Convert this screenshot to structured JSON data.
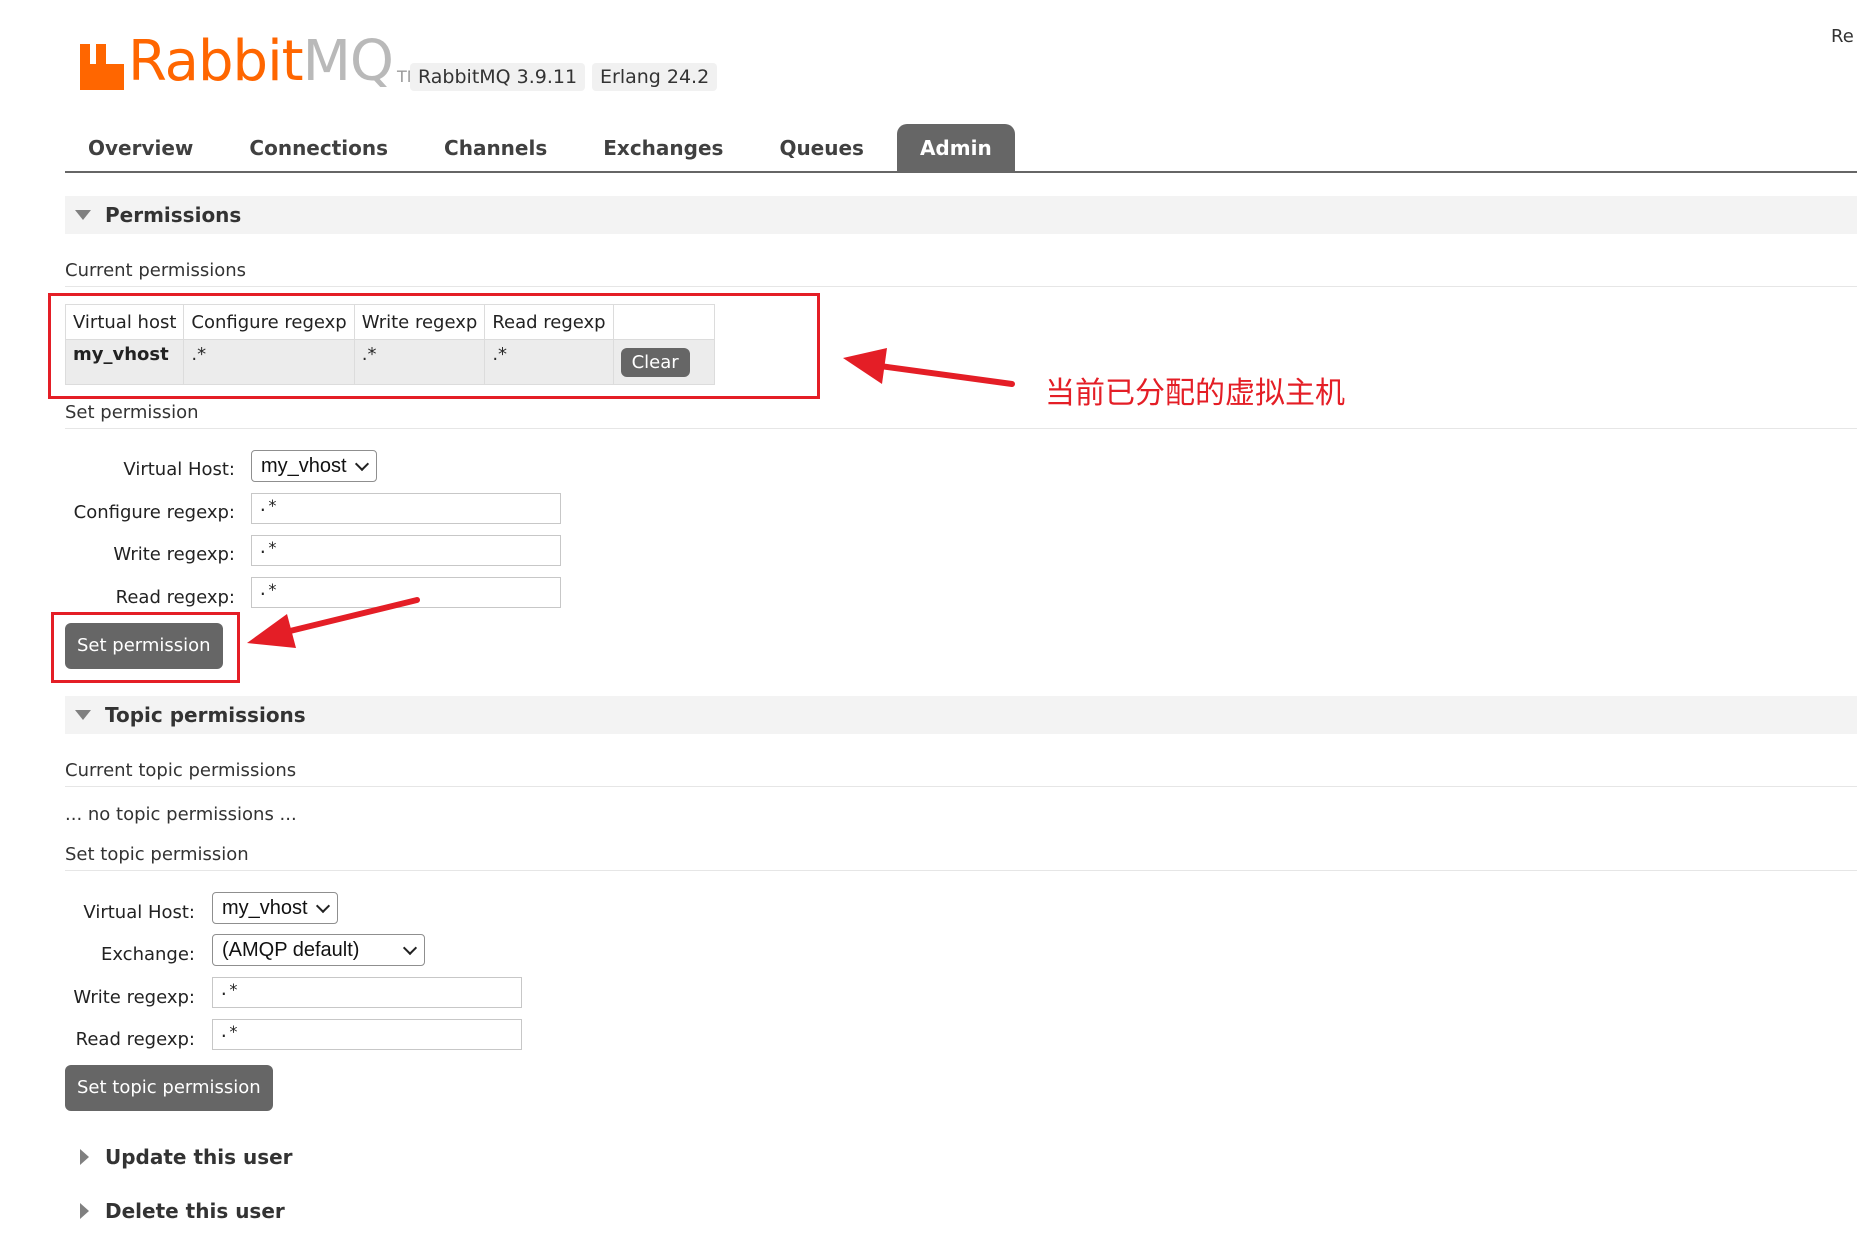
{
  "header": {
    "logo_rabbit": "Rabbit",
    "logo_mq": "MQ",
    "logo_tm": "TM",
    "version_rabbitmq": "RabbitMQ 3.9.11",
    "version_erlang": "Erlang 24.2",
    "corner_text": "Re"
  },
  "tabs": [
    {
      "label": "Overview",
      "active": false
    },
    {
      "label": "Connections",
      "active": false
    },
    {
      "label": "Channels",
      "active": false
    },
    {
      "label": "Exchanges",
      "active": false
    },
    {
      "label": "Queues",
      "active": false
    },
    {
      "label": "Admin",
      "active": true
    }
  ],
  "permissions": {
    "title": "Permissions",
    "current_title": "Current permissions",
    "table": {
      "headers": [
        "Virtual host",
        "Configure regexp",
        "Write regexp",
        "Read regexp",
        ""
      ],
      "rows": [
        {
          "vhost": "my_vhost",
          "configure": ".*",
          "write": ".*",
          "read": ".*",
          "action": "Clear"
        }
      ]
    },
    "set_title": "Set permission",
    "form": {
      "vhost_label": "Virtual Host:",
      "vhost_value": "my_vhost",
      "configure_label": "Configure regexp:",
      "configure_value": ".*",
      "write_label": "Write regexp:",
      "write_value": ".*",
      "read_label": "Read regexp:",
      "read_value": ".*",
      "submit": "Set permission"
    }
  },
  "topic_permissions": {
    "title": "Topic permissions",
    "current_title": "Current topic permissions",
    "empty_text": "... no topic permissions ...",
    "set_title": "Set topic permission",
    "form": {
      "vhost_label": "Virtual Host:",
      "vhost_value": "my_vhost",
      "exchange_label": "Exchange:",
      "exchange_value": "(AMQP default)",
      "write_label": "Write regexp:",
      "write_value": ".*",
      "read_label": "Read regexp:",
      "read_value": ".*",
      "submit": "Set topic permission"
    }
  },
  "collapsed_sections": {
    "update_user": "Update this user",
    "delete_user": "Delete this user"
  },
  "annotation": {
    "text": "当前已分配的虚拟主机",
    "color": "#e41e26"
  },
  "colors": {
    "brand": "#ff6600",
    "tab_active": "#666666",
    "button": "#666666"
  }
}
